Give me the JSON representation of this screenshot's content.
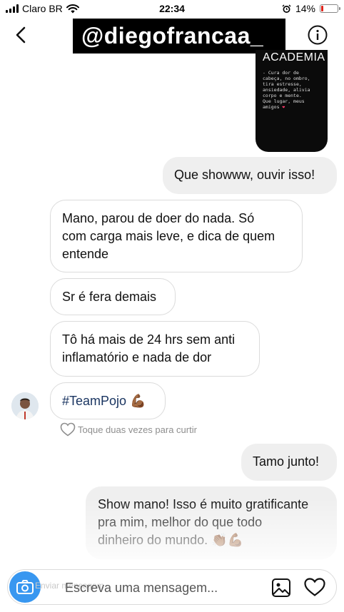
{
  "status_bar": {
    "carrier": "Claro BR",
    "time": "22:34",
    "battery_percent": "14%",
    "battery_level": 0.14,
    "battery_color": "#e0241b"
  },
  "header": {
    "username": "@diegofrancaa_"
  },
  "shared_image": {
    "title": "ACADEMIA",
    "caption": "- Cura dor de\ncabeça, no ombro,\ntira estresse,\nansiedade, alivia\ncorpo e mente.\nQue lugar, meus\namigos"
  },
  "messages": [
    {
      "direction": "sent",
      "text": "Que showww, ouvir isso!"
    },
    {
      "direction": "received",
      "text": "Mano, parou de doer do nada. Só\ncom carga mais leve, e dica de quem\nentende"
    },
    {
      "direction": "received",
      "text": "Sr é fera demais"
    },
    {
      "direction": "received",
      "text": "Tô há mais de 24 hrs sem anti\ninflamatório e nada de dor"
    },
    {
      "direction": "received",
      "text": "#TeamPojo",
      "emoji": "💪🏾"
    },
    {
      "direction": "sent",
      "text": "Tamo junto!"
    },
    {
      "direction": "sent",
      "text": "Show mano! Isso é muito gratificante\npra mim, melhor do que todo\ndinheiro do mundo.",
      "emoji": "👏🏾💪🏾"
    }
  ],
  "like_hint": "Toque duas vezes para curtir",
  "composer": {
    "camera_ghost": "Enviar mensagem",
    "placeholder": "Escreva uma mensagem..."
  },
  "colors": {
    "accent_blue": "#3897f0",
    "sent_bubble": "#efefef",
    "received_border": "#dbdbdb",
    "hashtag": "#1a3561"
  }
}
